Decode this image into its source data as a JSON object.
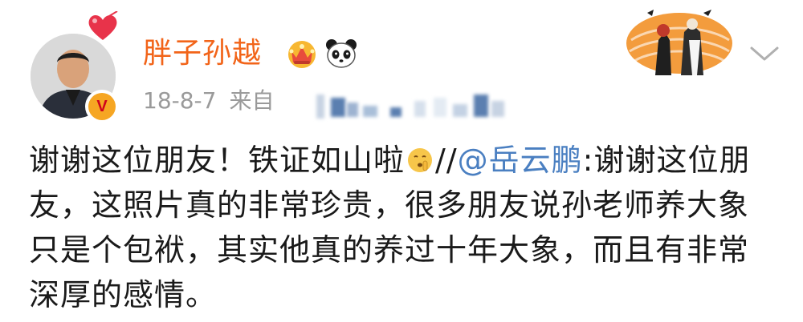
{
  "post": {
    "username": "胖子孙越",
    "date": "18-8-7",
    "source_prefix": "来自",
    "text_part1": "谢谢这位朋友！铁证如山啦",
    "repost_separator": "//",
    "mention": "@岳云鹏",
    "text_part2": ":谢谢这位朋友，这照片真的非常珍贵，很多朋友说孙老师养大象只是个包袱，其实他真的养过十年大象，而且有非常深厚的感情。"
  },
  "icons": {
    "verified": "verified-v-icon",
    "verified_letter": "V",
    "crown": "crown-member-icon",
    "panda": "panda-icon",
    "heart": "heart-decoration-icon",
    "emoji": "shush-emoji-icon",
    "menu": "chevron-down-icon"
  },
  "colors": {
    "username": "#f26419",
    "meta": "#9a9a9a",
    "mention": "#4a7fc1",
    "text": "#1a1a1a",
    "verified_bg": "#f6a623",
    "verified_letter": "#d0021b"
  }
}
